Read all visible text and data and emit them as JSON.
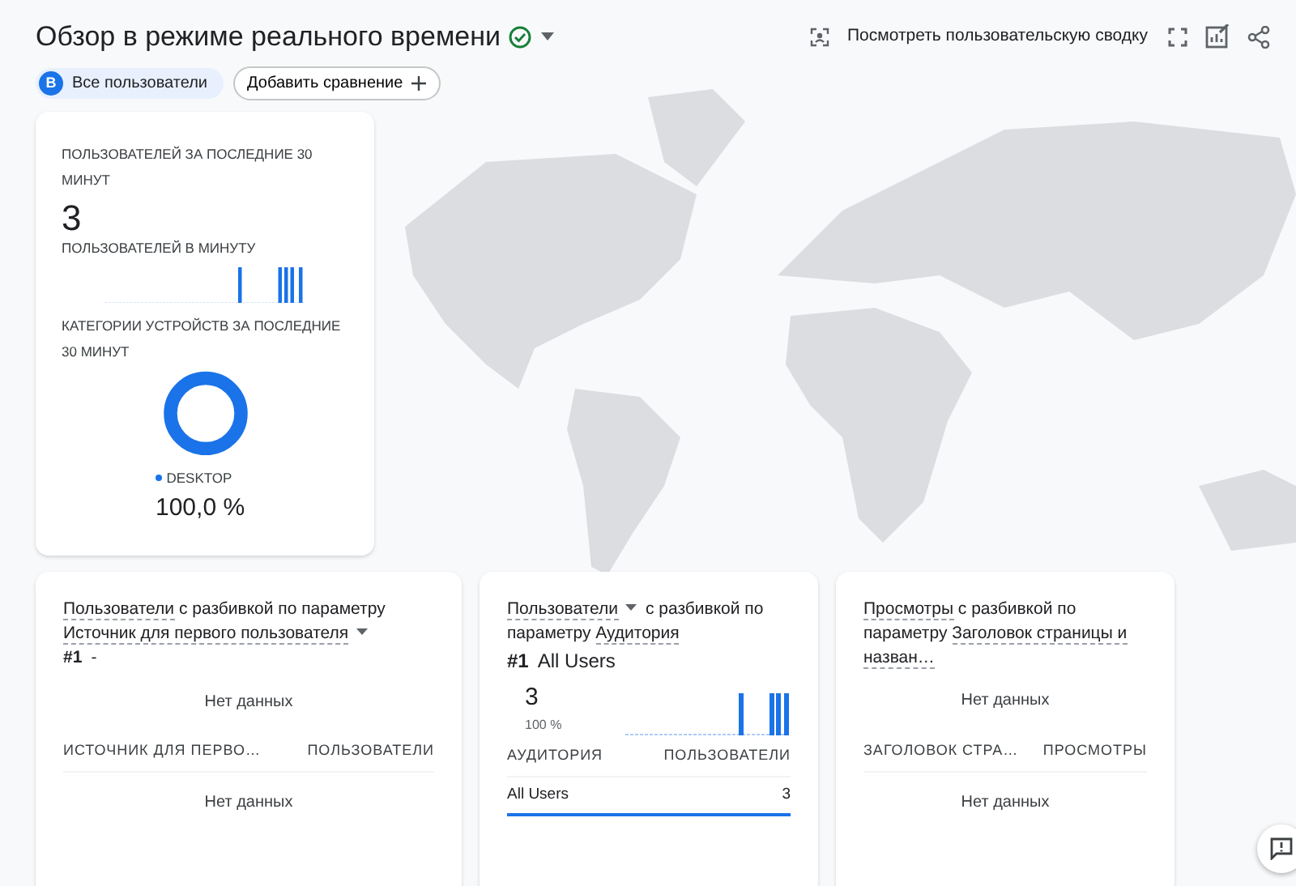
{
  "header": {
    "title": "Обзор в режиме реального времени",
    "view_button": "Посмотреть пользовательскую сводку"
  },
  "comparisons": {
    "avatar": "В",
    "segment": "Все пользователи",
    "add_button": "Добавить сравнение"
  },
  "realtime_card": {
    "users_label": "ПОЛЬЗОВАТЕЛЕЙ ЗА ПОСЛЕДНИЕ 30 МИНУТ",
    "users_value": "3",
    "per_minute_label": "ПОЛЬЗОВАТЕЛЕЙ В МИНУТУ",
    "devices_label": "КАТЕГОРИИ УСТРОЙСТВ ЗА ПОСЛЕДНИЕ 30 МИНУТ",
    "legend": [
      {
        "label": "DESKTOP",
        "value": "100,0 %",
        "color": "#1a73e8"
      }
    ]
  },
  "cards": [
    {
      "metric": "Пользователи",
      "metric_dropdown": false,
      "connector": "с разбивкой по параметру",
      "dimension": "Источник для первого пользователя",
      "dimension_dropdown": true,
      "rank": {
        "number": "#1",
        "label": "-"
      },
      "chart_empty": "Нет данных",
      "columns": [
        "ИСТОЧНИК ДЛЯ ПЕРВО…",
        "ПОЛЬЗОВАТЕЛИ"
      ],
      "table_empty": "Нет данных"
    },
    {
      "metric": "Пользователи",
      "metric_dropdown": true,
      "connector": "с разбивкой по параметру",
      "dimension": "Аудитория",
      "dimension_dropdown": false,
      "rank": {
        "number": "#1",
        "label": "All Users"
      },
      "summary": {
        "value": "3",
        "share": "100 %"
      },
      "columns": [
        "АУДИТОРИЯ",
        "ПОЛЬЗОВАТЕЛИ"
      ],
      "rows": [
        {
          "cells": [
            "All Users",
            "3"
          ],
          "selected": true
        }
      ]
    },
    {
      "metric": "Просмотры",
      "metric_dropdown": false,
      "connector": "с разбивкой по параметру",
      "dimension": "Заголовок страницы и назван…",
      "dimension_dropdown": false,
      "chart_empty": "Нет данных",
      "columns": [
        "ЗАГОЛОВОК СТРА…",
        "ПРОСМОТРЫ"
      ],
      "table_empty": "Нет данных"
    }
  ]
}
